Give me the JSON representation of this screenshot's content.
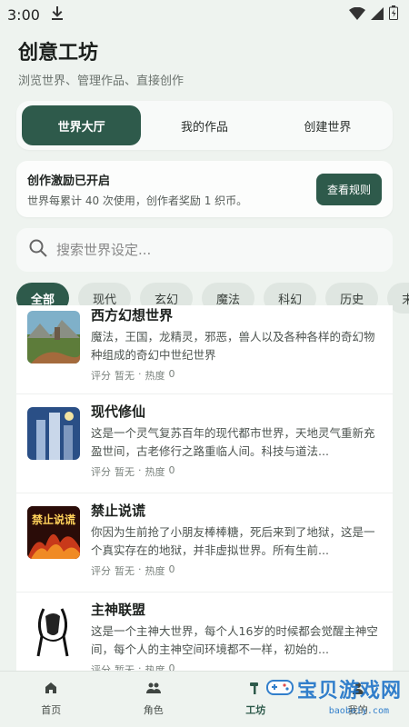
{
  "status": {
    "time": "3:00"
  },
  "header": {
    "title": "创意工坊",
    "subtitle": "浏览世界、管理作品、直接创作"
  },
  "tabs": [
    {
      "label": "世界大厅",
      "active": true
    },
    {
      "label": "我的作品",
      "active": false
    },
    {
      "label": "创建世界",
      "active": false
    }
  ],
  "promo": {
    "title": "创作激励已开启",
    "desc": "世界每累计 40 次使用，创作者奖励 1 织币。",
    "button": "查看规则"
  },
  "search": {
    "placeholder": "搜索世界设定..."
  },
  "chips": [
    "全部",
    "现代",
    "玄幻",
    "魔法",
    "科幻",
    "历史",
    "末"
  ],
  "worlds": [
    {
      "title": "西方幻想世界",
      "desc": "魔法，王国，龙精灵，邪恶，兽人以及各种各样的奇幻物种组成的奇幻中世纪世界",
      "rating_label": "评分",
      "rating": "暂无",
      "sep": "·",
      "heat_label": "热度",
      "heat": "0"
    },
    {
      "title": "现代修仙",
      "desc": "这是一个灵气复苏百年的现代都市世界，天地灵气重新充盈世间，古老修行之路重临人间。科技与道法...",
      "rating_label": "评分",
      "rating": "暂无",
      "sep": "·",
      "heat_label": "热度",
      "heat": "0"
    },
    {
      "title": "禁止说谎",
      "desc": "你因为生前抢了小朋友棒棒糖，死后来到了地狱，这是一个真实存在的地狱，并非虚拟世界。所有生前...",
      "rating_label": "评分",
      "rating": "暂无",
      "sep": "·",
      "heat_label": "热度",
      "heat": "0"
    },
    {
      "title": "主神联盟",
      "desc": "这是一个主神大世界，每个人16岁的时候都会觉醒主神空间，每个人的主神空间环境都不一样，初始的...",
      "rating_label": "评分",
      "rating": "暂无",
      "sep": "·",
      "heat_label": "热度",
      "heat": "0"
    }
  ],
  "thumb_text": {
    "lie": "禁止说谎"
  },
  "nav": [
    {
      "label": "首页",
      "icon": "home-icon"
    },
    {
      "label": "角色",
      "icon": "people-icon"
    },
    {
      "label": "工坊",
      "icon": "hammer-icon",
      "active": true
    },
    {
      "label": "我的",
      "icon": "person-icon"
    }
  ],
  "watermark": {
    "main": "宝贝游戏网",
    "sub": "baobeiy.com"
  },
  "colors": {
    "accent": "#2e5a4b",
    "background": "#eef3ef"
  }
}
